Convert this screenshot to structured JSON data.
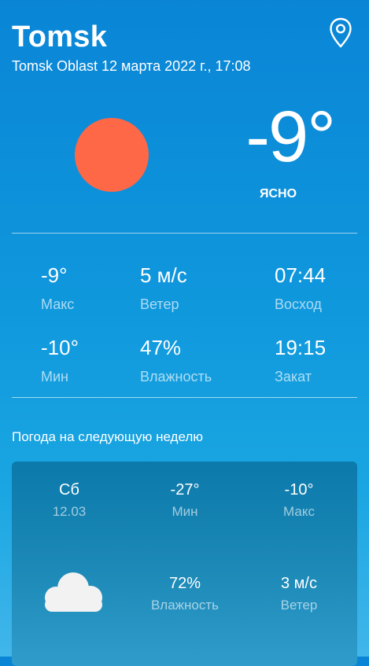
{
  "header": {
    "city": "Tomsk",
    "subtitle": "Tomsk Oblast 12 марта 2022 г., 17:08",
    "location_icon": "map-pin-icon"
  },
  "current": {
    "temp": "-9°",
    "condition": "ЯСНО",
    "weather_icon": "sun-icon",
    "sun_color": "#fe6847"
  },
  "stats": {
    "max": {
      "value": "-9°",
      "label": "Макс"
    },
    "wind": {
      "value": "5 м/с",
      "label": "Ветер"
    },
    "sunrise": {
      "value": "07:44",
      "label": "Восход"
    },
    "min": {
      "value": "-10°",
      "label": "Мин"
    },
    "humidity": {
      "value": "47%",
      "label": "Влажность"
    },
    "sunset": {
      "value": "19:15",
      "label": "Закат"
    }
  },
  "forecast": {
    "title": "Погода на следующую неделю",
    "day": {
      "weekday": "Сб",
      "date": "12.03",
      "min": "-27°",
      "min_label": "Мин",
      "max": "-10°",
      "max_label": "Макс",
      "humidity": "72%",
      "humidity_label": "Влажность",
      "wind": "3 м/с",
      "wind_label": "Ветер",
      "icon": "cloud-icon"
    }
  }
}
